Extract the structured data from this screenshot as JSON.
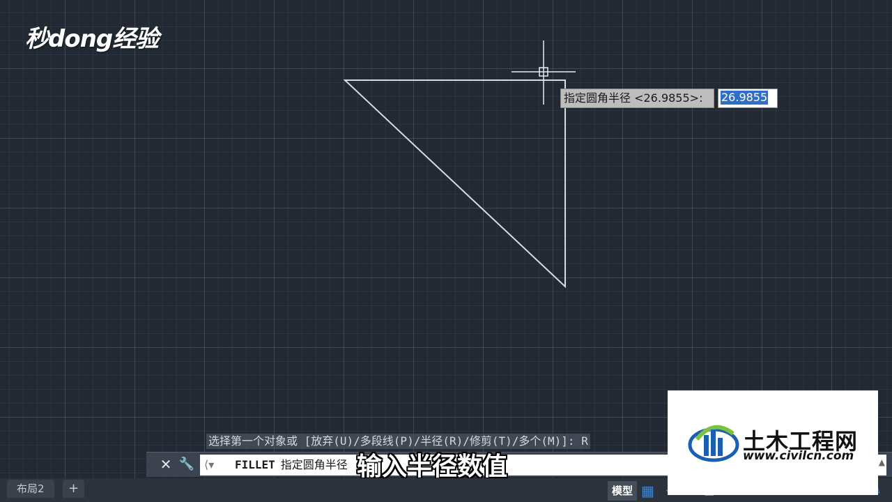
{
  "logo_text": "秒dong经验",
  "prompt": {
    "label": "指定圆角半径 <26.9855>:",
    "value": "26.9855"
  },
  "command_history": "选择第一个对象或 [放弃(U)/多段线(P)/半径(R)/修剪(T)/多个(M)]: R",
  "command_line": {
    "keyword": "FILLET",
    "text": "指定圆角半径"
  },
  "subtitle": "输入半径数值",
  "statusbar": {
    "tabs": [
      "布局2",
      "+"
    ],
    "model_label": "模型"
  },
  "watermark": {
    "name": "土木工程网",
    "url": "www.civilcn.com"
  },
  "colors": {
    "background": "#222933",
    "drawing_line": "#d8dde3",
    "highlight": "#2f6fc6"
  },
  "icons": {
    "close": "close-icon",
    "customize": "wrench-icon",
    "command_arrow": "command-arrow-icon",
    "grid": "grid-icon"
  }
}
